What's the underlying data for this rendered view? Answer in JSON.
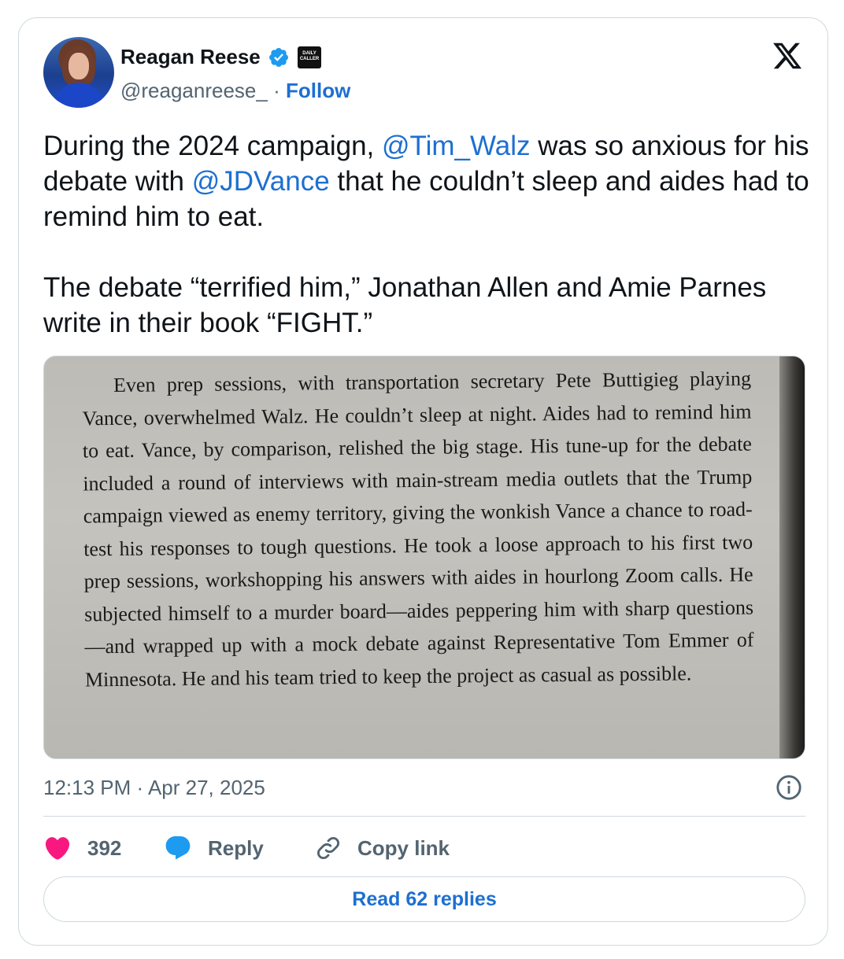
{
  "author": {
    "name": "Reagan Reese",
    "handle": "@reaganreese_",
    "separator": "·",
    "follow_label": "Follow",
    "org_badge_text": "DAILY CALLER"
  },
  "tweet": {
    "p1_before": "During the 2024 campaign, ",
    "mention_1": "@Tim_Walz",
    "p1_middle": " was so anxious for his debate with ",
    "mention_2": "@JDVance",
    "p1_after": " that he couldn’t sleep and aides had to remind him to eat.",
    "p2": "The debate “terrified him,” Jonathan Allen and Amie Parnes write in their book “FIGHT.”"
  },
  "book_photo": {
    "text": "Even prep sessions, with transportation secretary Pete Buttigieg playing Vance, overwhelmed Walz. He couldn’t sleep at night. Aides had to remind him to eat. Vance, by comparison, relished the big stage. His tune-up for the debate included a round of interviews with main-stream media outlets that the Trump campaign viewed as enemy territory, giving the wonkish Vance a chance to road-test his responses to tough questions. He took a loose approach to his first two prep sessions, workshopping his answers with aides in hourlong Zoom calls. He subjected himself to a murder board—aides peppering him with sharp questions—and wrapped up with a mock debate against Representative Tom Emmer of Minnesota. He and his team tried to keep the project as casual as possible."
  },
  "timestamp": "12:13 PM · Apr 27, 2025",
  "actions": {
    "like_count": "392",
    "reply_label": "Reply",
    "copy_link_label": "Copy link"
  },
  "read_replies_label": "Read 62 replies",
  "colors": {
    "link_blue": "#1d6fd1",
    "like_pink": "#f91880",
    "reply_blue": "#1d9bf0",
    "muted_gray": "#536471",
    "verified_blue": "#1d9bf0"
  },
  "icons": [
    "verified-badge-icon",
    "daily-caller-logo",
    "x-logo-icon",
    "info-icon",
    "heart-icon",
    "reply-bubble-icon",
    "link-icon"
  ]
}
